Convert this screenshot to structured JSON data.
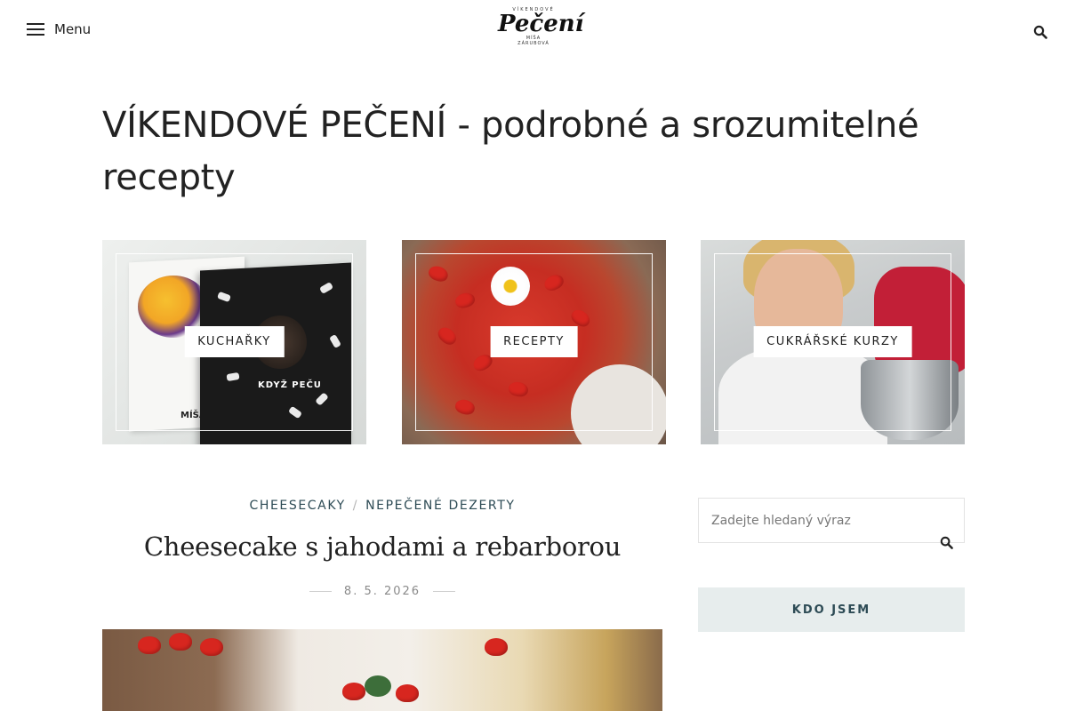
{
  "header": {
    "menu_label": "Menu",
    "logo": {
      "top_text": "VÍKENDOVÉ",
      "main_text": "Pečení",
      "sub_text": "MÍŠA",
      "sub_text_2": "ZÁRUBOVÁ"
    },
    "icons": {
      "menu": "hamburger-icon",
      "search": "search-icon"
    }
  },
  "page_title": "VÍKENDOVÉ PEČENÍ - podrobné a srozumitelné recepty",
  "tiles": [
    {
      "label": "KUCHAŘKY",
      "image": "cookbooks-photo",
      "book_title": "KDYŽ PEČU",
      "book_author": "MÍŠA"
    },
    {
      "label": "RECEPTY",
      "image": "strawberry-cheesecake-photo"
    },
    {
      "label": "CUKRÁŘSKÉ KURZY",
      "image": "baker-with-mixer-photo"
    }
  ],
  "post": {
    "categories": [
      "CHEESECAKY",
      "NEPEČENÉ DEZERTY"
    ],
    "category_separator": "/",
    "title": "Cheesecake s jahodami a rebarborou",
    "date": "8. 5. 2026",
    "image": "cheesecake-strawberries-photo"
  },
  "sidebar": {
    "search_placeholder": "Zadejte hledaný výraz",
    "search_value": "",
    "about_label": "KDO JSEM"
  },
  "colors": {
    "text": "#222222",
    "accent": "#2d4b55",
    "muted": "#8a8a8a",
    "button_bg": "#e7eded"
  }
}
